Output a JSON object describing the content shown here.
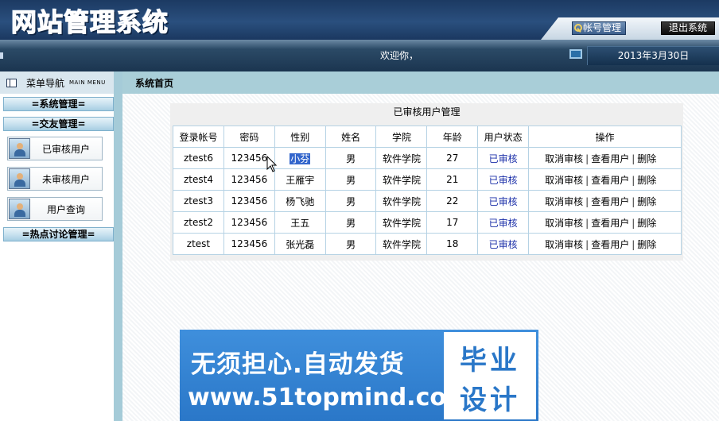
{
  "header": {
    "logo_text": "网站管理系统",
    "account_button": "帐号管理",
    "logout_button": "退出系统"
  },
  "statusbar": {
    "welcome": "欢迎你，",
    "date": "2013年3月30日"
  },
  "sidebar": {
    "title": "菜单导航",
    "subtitle": "MAIN MENU",
    "sections": [
      {
        "label": "=系统管理="
      },
      {
        "label": "=交友管理="
      },
      {
        "label": "=热点讨论管理="
      }
    ],
    "items": [
      {
        "label": "已审核用户"
      },
      {
        "label": "未审核用户"
      },
      {
        "label": "用户查询"
      }
    ]
  },
  "main": {
    "page_title": "系统首页",
    "panel_title": "已审核用户管理",
    "columns": [
      "登录帐号",
      "密码",
      "性别",
      "姓名",
      "学院",
      "年龄",
      "用户状态",
      "操作"
    ],
    "rows": [
      {
        "account": "ztest6",
        "password": "123456",
        "gender": "小芬",
        "name": "男",
        "college": "软件学院",
        "age": "27",
        "status": "已审核"
      },
      {
        "account": "ztest4",
        "password": "123456",
        "gender": "王雁宇",
        "name": "男",
        "college": "软件学院",
        "age": "21",
        "status": "已审核"
      },
      {
        "account": "ztest3",
        "password": "123456",
        "gender": "杨飞驰",
        "name": "男",
        "college": "软件学院",
        "age": "22",
        "status": "已审核"
      },
      {
        "account": "ztest2",
        "password": "123456",
        "gender": "王五",
        "name": "男",
        "college": "软件学院",
        "age": "17",
        "status": "已审核"
      },
      {
        "account": "ztest",
        "password": "123456",
        "gender": "张光磊",
        "name": "男",
        "college": "软件学院",
        "age": "18",
        "status": "已审核"
      }
    ],
    "actions": {
      "cancel": "取消审核",
      "view": "查看用户",
      "delete": "删除",
      "separator": "|"
    }
  },
  "banner": {
    "line1": "无须担心.自动发货",
    "line2": "www.51topmind.com",
    "stamp_top": "毕业",
    "stamp_bottom": "设计"
  },
  "colors": {
    "header_bg": "#1c3a62",
    "sidebar_border": "#a5cbd8",
    "table_border": "#b5d2e4",
    "status_text": "#1a2ea8",
    "banner_bg": "#2a77c8"
  }
}
